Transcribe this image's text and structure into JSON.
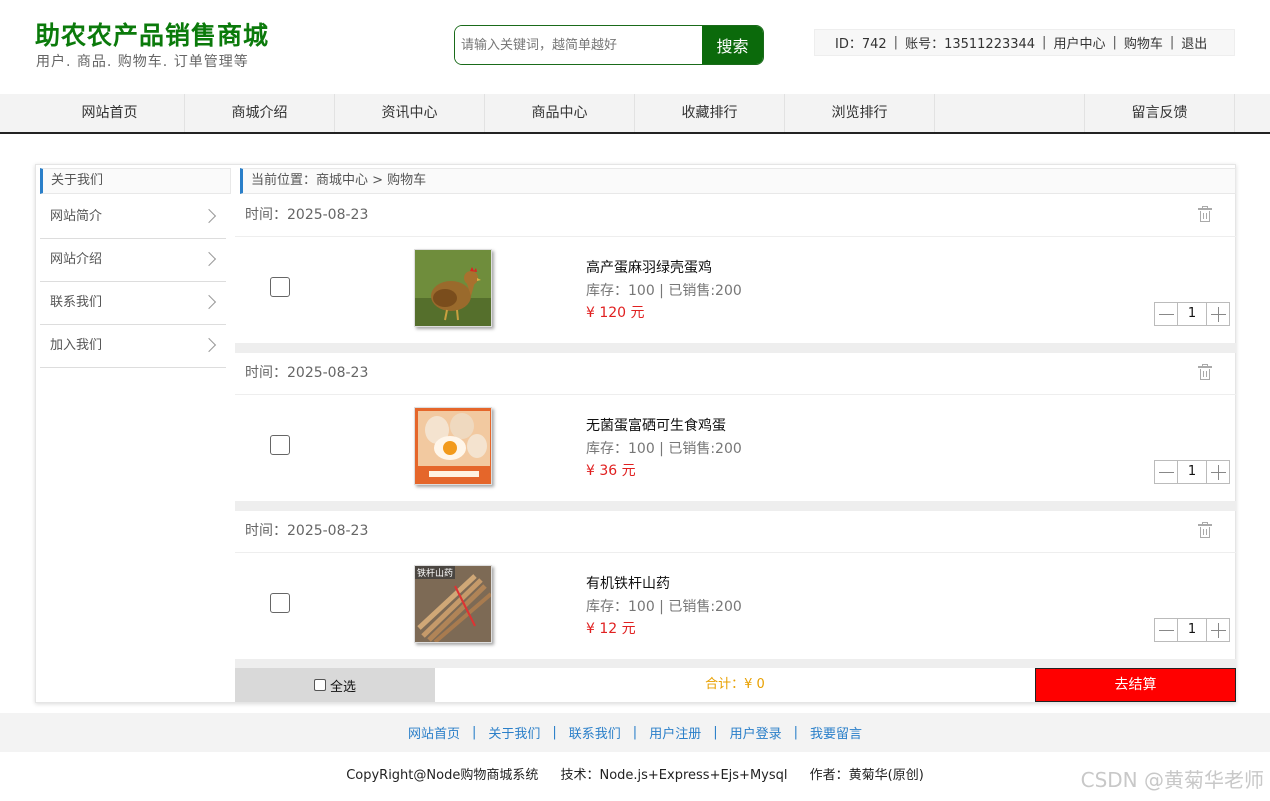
{
  "header": {
    "brand_title": "助农农产品销售商城",
    "brand_subtitle": "用户. 商品. 购物车. 订单管理等",
    "search_placeholder": "请输入关键词，越简单越好",
    "search_button": "搜索",
    "user": {
      "id_label": "ID：742",
      "account_label": "账号：13511223344",
      "user_center": "用户中心",
      "cart": "购物车",
      "logout": "退出"
    }
  },
  "nav": {
    "items": [
      "网站首页",
      "商城介绍",
      "资讯中心",
      "商品中心",
      "收藏排行",
      "浏览排行",
      "留言反馈"
    ]
  },
  "sidebar": {
    "title": "关于我们",
    "items": [
      "网站简介",
      "网站介绍",
      "联系我们",
      "加入我们"
    ]
  },
  "breadcrumb": "当前位置：商城中心 > 购物车",
  "cart": {
    "items": [
      {
        "time": "时间：2025-08-23",
        "name": "高产蛋麻羽绿壳蛋鸡",
        "stock": "库存：100 | 已销售:200",
        "price": "¥ 120 元",
        "qty": "1",
        "image": "hen-photo"
      },
      {
        "time": "时间：2025-08-23",
        "name": "无菌蛋富硒可生食鸡蛋",
        "stock": "库存：100 | 已销售:200",
        "price": "¥ 36 元",
        "qty": "1",
        "image": "eggs-photo"
      },
      {
        "time": "时间：2025-08-23",
        "name": "有机铁杆山药",
        "stock": "库存：100 | 已销售:200",
        "price": "¥ 12 元",
        "qty": "1",
        "image": "yam-photo"
      }
    ],
    "select_all": "全选",
    "total": "合计：¥ 0",
    "checkout": "去结算",
    "yam_image_text": "铁杆山药"
  },
  "footer": {
    "links": [
      "网站首页",
      "关于我们",
      "联系我们",
      "用户注册",
      "用户登录",
      "我要留言"
    ],
    "copyright": "CopyRight@Node购物商城系统",
    "tech": "技术：Node.js+Express+Ejs+Mysql",
    "author": "作者：黄菊华(原创)"
  },
  "watermark": "CSDN @黄菊华老师",
  "colors": {
    "brand": "#0b7a0b",
    "accent": "#2a7fc9",
    "price": "#e02020",
    "checkout": "#ff0000"
  }
}
